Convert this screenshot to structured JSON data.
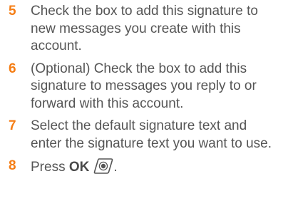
{
  "steps": [
    {
      "number": "5",
      "text": "Check the box to add this signature to new messages you create with this account."
    },
    {
      "number": "6",
      "text": "(Optional)  Check the box to add this signature to messages you reply to or forward with this account."
    },
    {
      "number": "7",
      "text": "Select the default signature text and enter the signature text you want to use."
    },
    {
      "number": "8",
      "text_before": "Press ",
      "bold_text": "OK",
      "text_after": ".",
      "icon": "ok-button-icon"
    }
  ],
  "colors": {
    "step_number": "#f57d14",
    "body_text": "#555555"
  }
}
